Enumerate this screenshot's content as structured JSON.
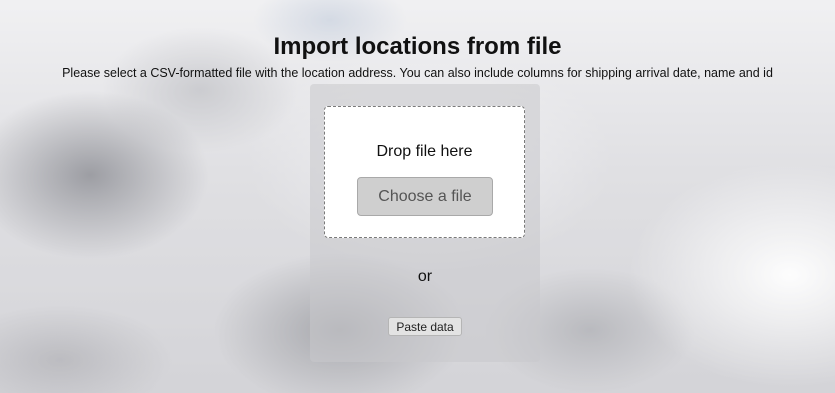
{
  "page": {
    "title": "Import locations from file",
    "subtitle": "Please select a CSV-formatted file with the location address. You can also include columns for shipping arrival date, name and id"
  },
  "dropzone": {
    "label": "Drop file here",
    "choose_button": "Choose a file"
  },
  "separator": "or",
  "paste_button": "Paste data",
  "colors": {
    "dropzone_border": "#7a7a7a",
    "button_bg": "#cfcfcf",
    "panel_bg": "rgba(200,200,204,0.55)"
  }
}
